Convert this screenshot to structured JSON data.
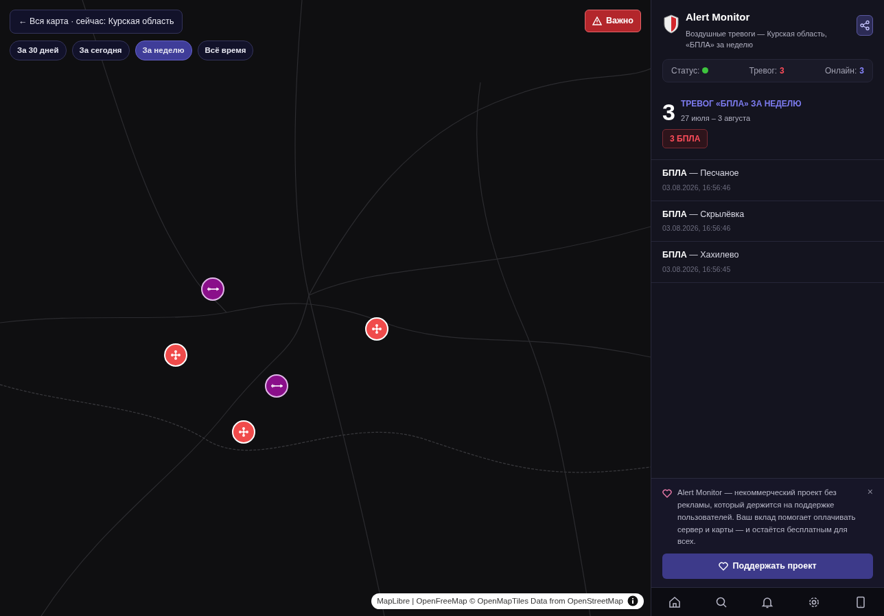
{
  "map": {
    "back_button": {
      "icon": "←",
      "label": "Вся карта · сейчас: Курская область"
    },
    "periods": [
      {
        "label": "За 30 дней",
        "selected": false
      },
      {
        "label": "За сегодня",
        "selected": false
      },
      {
        "label": "За неделю",
        "selected": true
      },
      {
        "label": "Всё время",
        "selected": false
      }
    ],
    "important_button": "Важно",
    "markers": [
      {
        "kind": "missile"
      },
      {
        "kind": "drone"
      },
      {
        "kind": "drone"
      },
      {
        "kind": "missile"
      },
      {
        "kind": "drone"
      }
    ],
    "attribution": "MapLibre | OpenFreeMap © OpenMapTiles Data from OpenStreetMap"
  },
  "sidebar": {
    "app_title": "Alert Monitor",
    "subtitle": "Воздушные тревоги — Курская область, «БПЛА» за неделю",
    "status": {
      "label": "Статус:",
      "online": true,
      "alerts_label": "Тревог:",
      "alerts": "3",
      "online_label": "Онлайн:",
      "online_count": "3"
    },
    "summary": {
      "count": "3",
      "title": "ТРЕВОГ «БПЛА» ЗА НЕДЕЛЮ",
      "range": "27 июля – 3 августа",
      "tag": "3 БПЛА"
    },
    "alerts": [
      {
        "type": "БПЛА",
        "place": "— Песчаное",
        "time": "03.08.2026, 16:56:46"
      },
      {
        "type": "БПЛА",
        "place": "— Скрылёвка",
        "time": "03.08.2026, 16:56:46"
      },
      {
        "type": "БПЛА",
        "place": "— Хахилево",
        "time": "03.08.2026, 16:56:45"
      }
    ],
    "support": {
      "text": "Alert Monitor — некоммерческий проект без рекламы, который держится на поддержке пользователей. Ваш вклад помогает оплачивать сервер и карты — и остаётся бесплатным для всех.",
      "close": "×",
      "button": "Поддержать проект"
    },
    "nav": [
      {
        "kind": "home"
      },
      {
        "kind": "search"
      },
      {
        "kind": "bell"
      },
      {
        "kind": "settings"
      },
      {
        "kind": "phone"
      }
    ]
  }
}
